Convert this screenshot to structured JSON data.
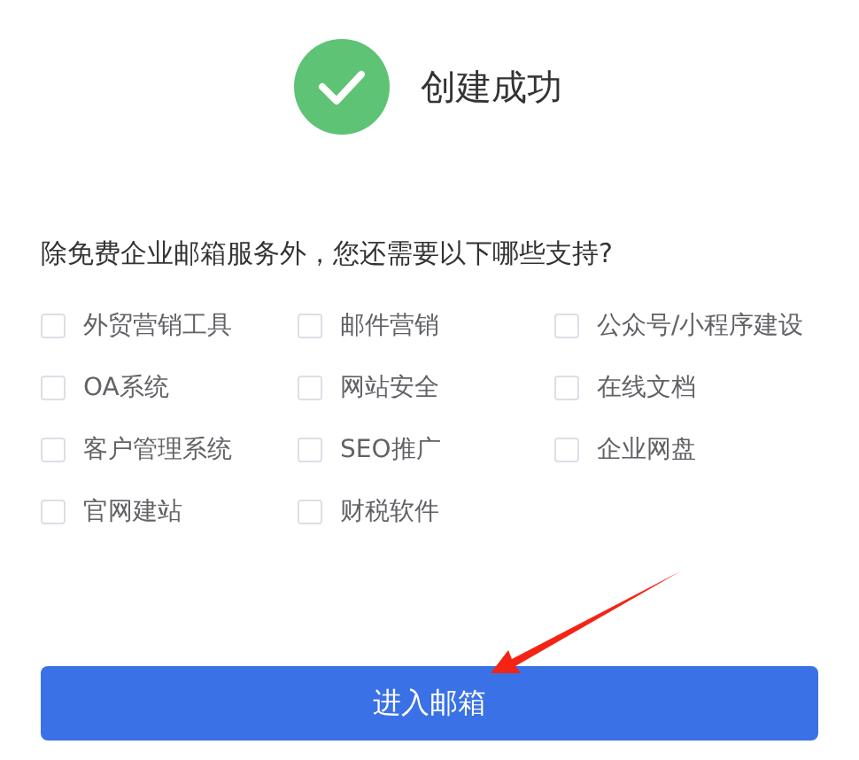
{
  "header": {
    "title": "创建成功"
  },
  "question": "除免费企业邮箱服务外，您还需要以下哪些支持?",
  "options": [
    {
      "label": "外贸营销工具",
      "checked": false
    },
    {
      "label": "邮件营销",
      "checked": false
    },
    {
      "label": "公众号/小程序建设",
      "checked": false
    },
    {
      "label": "OA系统",
      "checked": false
    },
    {
      "label": "网站安全",
      "checked": false
    },
    {
      "label": "在线文档",
      "checked": false
    },
    {
      "label": "客户管理系统",
      "checked": false
    },
    {
      "label": "SEO推广",
      "checked": false
    },
    {
      "label": "企业网盘",
      "checked": false
    },
    {
      "label": "官网建站",
      "checked": false
    },
    {
      "label": "财税软件",
      "checked": false
    }
  ],
  "button": {
    "label": "进入邮箱"
  }
}
